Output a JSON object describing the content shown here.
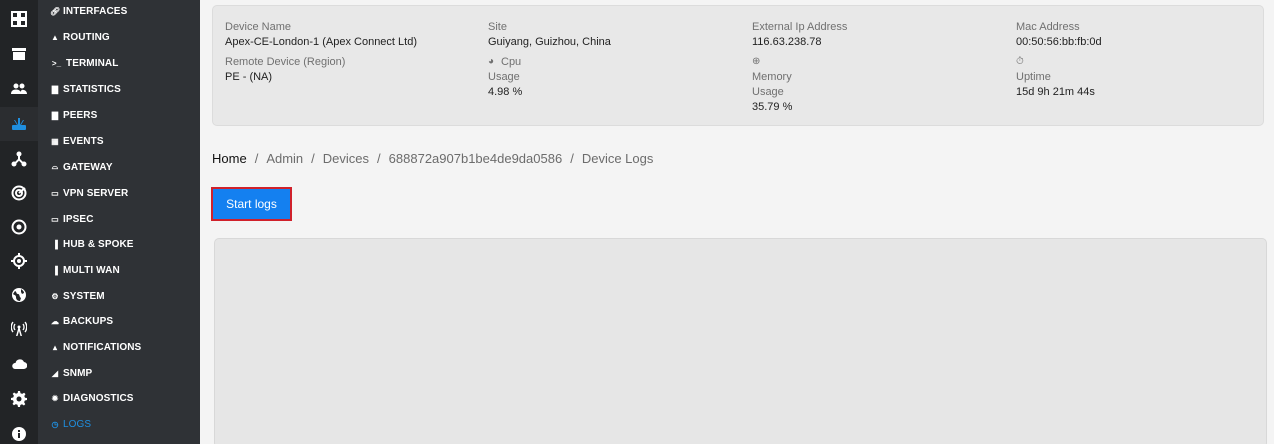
{
  "rail": {
    "icons": [
      "dashboard-icon",
      "store-icon",
      "users-icon",
      "router-icon",
      "topology-icon",
      "radar-icon",
      "circle-dot-icon",
      "location-target-icon",
      "globe-icon",
      "antenna-icon",
      "cloud-icon",
      "gear-icon",
      "info-icon"
    ],
    "active": "router-icon"
  },
  "submenu": {
    "items": [
      {
        "label": "INTERFACES",
        "icon": "link-icon"
      },
      {
        "label": "ROUTING",
        "icon": "road-icon"
      },
      {
        "label": "TERMINAL",
        "icon": "terminal-icon"
      },
      {
        "label": "STATISTICS",
        "icon": "bar-chart-icon"
      },
      {
        "label": "PEERS",
        "icon": "bar-chart-icon"
      },
      {
        "label": "EVENTS",
        "icon": "calendar-icon"
      },
      {
        "label": "GATEWAY",
        "icon": "wifi-icon"
      },
      {
        "label": "VPN SERVER",
        "icon": "server-icon"
      },
      {
        "label": "IPSEC",
        "icon": "server-icon"
      },
      {
        "label": "HUB & SPOKE",
        "icon": "books-icon"
      },
      {
        "label": "MULTI WAN",
        "icon": "books-icon"
      },
      {
        "label": "SYSTEM",
        "icon": "gear-icon"
      },
      {
        "label": "BACKUPS",
        "icon": "cloud-upload-icon"
      },
      {
        "label": "NOTIFICATIONS",
        "icon": "bell-icon"
      },
      {
        "label": "SNMP",
        "icon": "signal-icon"
      },
      {
        "label": "DIAGNOSTICS",
        "icon": "bug-icon"
      },
      {
        "label": "LOGS",
        "icon": "clock-icon"
      }
    ],
    "active": "LOGS"
  },
  "device": {
    "name_label": "Device Name",
    "name_value": "Apex-CE-London-1 (Apex Connect Ltd)",
    "site_label": "Site",
    "site_value": "Guiyang, Guizhou, China",
    "ext_ip_label": "External Ip Address",
    "ext_ip_value": "116.63.238.78",
    "mac_label": "Mac Address",
    "mac_value": "00:50:56:bb:fb:0d",
    "remote_label": "Remote Device (Region)",
    "remote_value": "PE - (NA)",
    "cpu_label": "Cpu",
    "cpu_usage_label": "Usage",
    "cpu_value": "4.98 %",
    "memory_label": "Memory",
    "memory_usage_label": "Usage",
    "memory_value": "35.79 %",
    "uptime_label": "Uptime",
    "uptime_value": "15d 9h 21m 44s"
  },
  "breadcrumb": {
    "home": "Home",
    "admin": "Admin",
    "devices": "Devices",
    "device_id": "688872a907b1be4de9da0586",
    "current": "Device Logs",
    "separator": "/"
  },
  "actions": {
    "start_logs": "Start logs"
  },
  "colors": {
    "accent": "#1f8fe0",
    "button": "#1480f0",
    "button_outline": "#d0212b"
  }
}
